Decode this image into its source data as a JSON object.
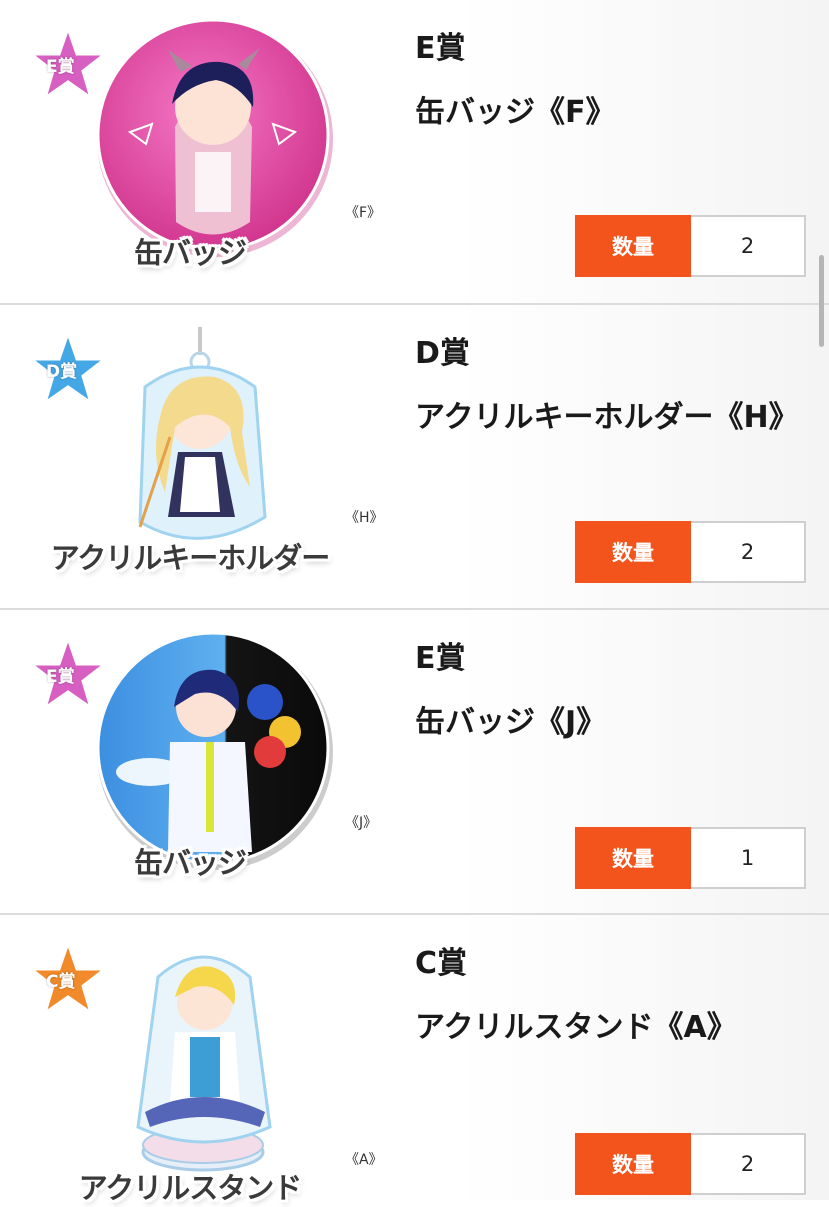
{
  "items": [
    {
      "prize": "E賞",
      "name": "缶バッジ《F》",
      "image_caption": "缶バッジ",
      "variant_tag": "《F》",
      "star_label": "E賞",
      "star_color": "#d75fc2",
      "qty_label": "数量",
      "qty_value": "2"
    },
    {
      "prize": "D賞",
      "name": "アクリルキーホルダー《H》",
      "image_caption": "アクリルキーホルダー",
      "variant_tag": "《H》",
      "star_label": "D賞",
      "star_color": "#45a8e6",
      "qty_label": "数量",
      "qty_value": "2"
    },
    {
      "prize": "E賞",
      "name": "缶バッジ《J》",
      "image_caption": "缶バッジ",
      "variant_tag": "《J》",
      "star_label": "E賞",
      "star_color": "#d75fc2",
      "qty_label": "数量",
      "qty_value": "1"
    },
    {
      "prize": "C賞",
      "name": "アクリルスタンド《A》",
      "image_caption": "アクリルスタンド",
      "variant_tag": "《A》",
      "star_label": "C賞",
      "star_color": "#f08a2a",
      "qty_label": "数量",
      "qty_value": "2"
    }
  ],
  "colors": {
    "accent": "#f2541b",
    "divider": "#dcdcdc"
  }
}
